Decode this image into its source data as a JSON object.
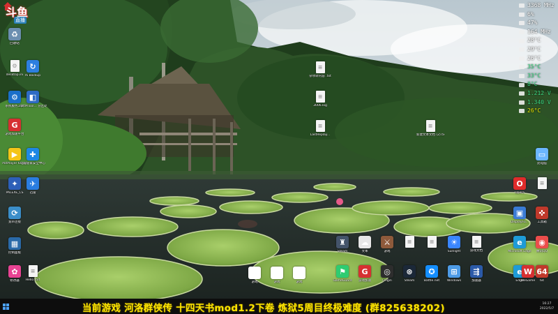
{
  "logo": {
    "brand": "斗鱼",
    "sub": "直播"
  },
  "monitor": {
    "stats": [
      {
        "value": "3368 MHz",
        "color": "#ffffff"
      },
      {
        "value": "6%",
        "color": "#ffffff"
      },
      {
        "value": "47%",
        "color": "#ffffff"
      },
      {
        "value": "164 MHz",
        "color": "#ffffff"
      },
      {
        "value": "28°C",
        "color": "#ffffff"
      },
      {
        "value": "29°C",
        "color": "#ffffff"
      },
      {
        "value": "26°C",
        "color": "#ffffff"
      },
      {
        "value": "35°C",
        "color": "#3ddc84"
      },
      {
        "value": "33°C",
        "color": "#3ddc84"
      },
      {
        "value": "8°C",
        "color": "#3ddc84"
      },
      {
        "value": "1.212 V",
        "color": "#3ddc84"
      },
      {
        "value": "1.340 V",
        "color": "#3ddc84"
      },
      {
        "value": "26°C",
        "color": "#e6e600"
      }
    ]
  },
  "desktop_icons": [
    {
      "id": "recycle",
      "label": "回收站",
      "icon": "recycle-icon",
      "color": "#6c8fb0",
      "glyph": "♻"
    },
    {
      "id": "desktop-ini",
      "label": "desktop.ini",
      "icon": "file-icon",
      "color": "#8a8a8a",
      "glyph": "⚙"
    },
    {
      "id": "haibackup",
      "label": "Ai Backup",
      "icon": "backup-icon",
      "color": "#2d7fe0",
      "glyph": "↻"
    },
    {
      "id": "steam-left",
      "label": "系统服务工具",
      "icon": "gear-app-icon",
      "color": "#1b6fc9",
      "glyph": "⚙"
    },
    {
      "id": "partmaster",
      "label": "PartMTool...\n分区助手",
      "icon": "partition-icon",
      "color": "#2e6bc4",
      "glyph": "◧"
    },
    {
      "id": "game-plat",
      "label": "游戏加速平台",
      "icon": "game-g-icon",
      "color": "#d63031",
      "glyph": "G"
    },
    {
      "id": "potplayer",
      "label": "PotPlayer 64 bit",
      "icon": "potplayer-icon",
      "color": "#f5c518",
      "glyph": "▶"
    },
    {
      "id": "security",
      "label": "电脑管家安全中心",
      "icon": "shield-icon",
      "color": "#1e88e5",
      "glyph": "✚"
    },
    {
      "id": "pal",
      "label": "PALEXE_CS",
      "icon": "palexe-icon",
      "color": "#2d5fb8",
      "glyph": "✦"
    },
    {
      "id": "feishu",
      "label": "迅雷",
      "icon": "bird-icon",
      "color": "#2a7de1",
      "glyph": "✈"
    },
    {
      "id": "network",
      "label": "宽带连接",
      "icon": "network-icon",
      "color": "#3b8ec9",
      "glyph": "⟳"
    },
    {
      "id": "control",
      "label": "控制面板",
      "icon": "control-panel-icon",
      "color": "#2a6aa8",
      "glyph": "▦"
    },
    {
      "id": "mod-tool",
      "label": "修改器",
      "icon": "pink-app-icon",
      "color": "#e84393",
      "glyph": "✿"
    },
    {
      "id": "hello-txt",
      "label": "Hello .txt",
      "icon": "file-icon",
      "color": "#f0f0f0",
      "glyph": "≡"
    },
    {
      "id": "txt-1",
      "label": "杂项转内容\n.txt",
      "icon": "file-icon",
      "color": "#f0f0f0",
      "glyph": "≡"
    },
    {
      "id": "file-3006",
      "label": "3006.log",
      "icon": "file-icon",
      "color": "#f0f0f0",
      "glyph": "≡"
    },
    {
      "id": "lastreplay",
      "label": "LastReplay...",
      "icon": "file-icon",
      "color": "#f0f0f0",
      "glyph": "≡"
    },
    {
      "id": "new-txt",
      "label": "新建文本文档\n(2).txt",
      "icon": "file-icon",
      "color": "#f0f0f0",
      "glyph": "≡"
    },
    {
      "id": "this-pc",
      "label": "此电脑",
      "icon": "computer-icon",
      "color": "#6bb6ff",
      "glyph": "▭"
    },
    {
      "id": "opera",
      "label": "Opera",
      "icon": "opera-icon",
      "color": "#e02b2b",
      "glyph": "O"
    },
    {
      "id": "blank-doc",
      "label": "",
      "icon": "file-icon",
      "color": "#f0f0f0",
      "glyph": "≡"
    },
    {
      "id": "dualmon",
      "label": "DisplayFu...",
      "icon": "display-icon",
      "color": "#3a7bd5",
      "glyph": "▣"
    },
    {
      "id": "tools-right",
      "label": "工具箱",
      "icon": "tools-icon",
      "color": "#c0392b",
      "glyph": "✜"
    },
    {
      "id": "edge-right",
      "label": "Microsoft Edge",
      "icon": "edge-icon",
      "color": "#1e9bd7",
      "glyph": "e"
    },
    {
      "id": "qq",
      "label": "腾讯QQ",
      "icon": "qq-icon",
      "color": "#eb4d4b",
      "glyph": "◉"
    },
    {
      "id": "bottom-1",
      "label": "Steam",
      "icon": "game-icon",
      "color": "#44546a",
      "glyph": "♜"
    },
    {
      "id": "bottom-2",
      "label": "文本",
      "icon": "sheep-icon",
      "color": "#e7e7e7",
      "glyph": "☁"
    },
    {
      "id": "bottom-3",
      "label": "游戏",
      "icon": "game-icon",
      "color": "#8e5a3b",
      "glyph": "⚔"
    },
    {
      "id": "bottom-4",
      "label": "",
      "icon": "file-icon",
      "color": "#f0f0f0",
      "glyph": "≡"
    },
    {
      "id": "bottom-5",
      "label": "",
      "icon": "file-icon",
      "color": "#f0f0f0",
      "glyph": "≡"
    },
    {
      "id": "bottom-6",
      "label": "Sunlight",
      "icon": "sun-app-icon",
      "color": "#3a86ff",
      "glyph": "☀"
    },
    {
      "id": "bottom-7",
      "label": "游戏文档",
      "icon": "file-icon",
      "color": "#f0f0f0",
      "glyph": "≡"
    },
    {
      "id": "bottom-8",
      "label": "GameGuard",
      "icon": "game-icon",
      "color": "#2ecc71",
      "glyph": "⚑"
    },
    {
      "id": "bottom-9",
      "label": "游戏加速",
      "icon": "game-g-icon",
      "color": "#d63031",
      "glyph": "G"
    },
    {
      "id": "bottom-10",
      "label": "Origin",
      "icon": "game-icon",
      "color": "#2d2d2d",
      "glyph": "◎"
    },
    {
      "id": "bottom-11",
      "label": "Steam",
      "icon": "steam-icon",
      "color": "#1b2838",
      "glyph": "⊛"
    },
    {
      "id": "bottom-12",
      "label": "Battle.net",
      "icon": "battlenet-icon",
      "color": "#148eff",
      "glyph": "✪"
    },
    {
      "id": "bottom-13",
      "label": "Windows",
      "icon": "windows-icon",
      "color": "#4d9be6",
      "glyph": "⊞"
    },
    {
      "id": "bottom-14",
      "label": "加速器",
      "icon": "accelerator-icon",
      "color": "#2b5aa8",
      "glyph": "⇶"
    },
    {
      "id": "bottom-15",
      "label": "游戏",
      "icon": "controller-icon",
      "color": "#ffffff",
      "glyph": "✚"
    },
    {
      "id": "bottom-16",
      "label": "游戏",
      "icon": "controller-icon",
      "color": "#ffffff",
      "glyph": "✚"
    },
    {
      "id": "bottom-17",
      "label": "游戏",
      "icon": "controller-icon",
      "color": "#ffffff",
      "glyph": "✚"
    },
    {
      "id": "bottom-18",
      "label": "Edge",
      "icon": "edge-icon",
      "color": "#1e9bd7",
      "glyph": "e"
    },
    {
      "id": "bottom-19",
      "label": "WeGame",
      "icon": "wegame-icon",
      "color": "#d63031",
      "glyph": "W"
    },
    {
      "id": "bottom-20",
      "label": "64",
      "icon": "app-64-icon",
      "color": "#c0392b",
      "glyph": "64"
    }
  ],
  "banner": {
    "text": "当前游戏 河洛群侠传  十四天书mod1.2下卷  炼狱5周目终极难度  (群825638202)"
  },
  "clock": {
    "time": "16:27",
    "date": "2022/5/7"
  }
}
